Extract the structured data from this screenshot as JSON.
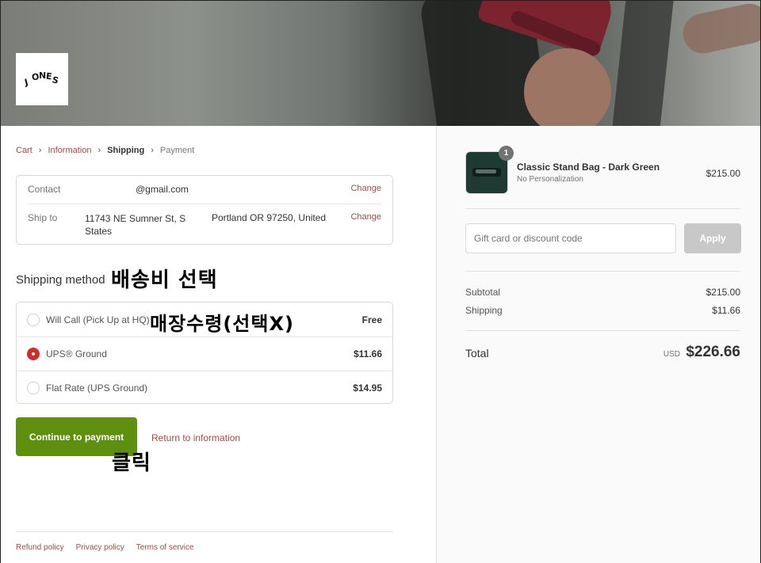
{
  "store": {
    "logo_text": "JONES"
  },
  "breadcrumb": {
    "cart": "Cart",
    "information": "Information",
    "shipping": "Shipping",
    "payment": "Payment"
  },
  "review": {
    "contact_label": "Contact",
    "contact_value": "@gmail.com",
    "shipto_label": "Ship to",
    "shipto_line1": "11743 NE Sumner St, S",
    "shipto_line1b": "States",
    "shipto_line2": "Portland OR 97250, United",
    "change": "Change"
  },
  "shipping_method": {
    "title": "Shipping method",
    "options": [
      {
        "name": "Will Call (Pick Up at HQ)",
        "price": "Free",
        "selected": false
      },
      {
        "name": "UPS® Ground",
        "price": "$11.66",
        "selected": true
      },
      {
        "name": "Flat Rate (UPS Ground)",
        "price": "$14.95",
        "selected": false
      }
    ]
  },
  "annotations": {
    "select_shipping": "배송비 선택",
    "store_pickup": "매장수령(선택X)",
    "click": "클릭"
  },
  "actions": {
    "continue": "Continue to payment",
    "return": "Return to information"
  },
  "footer": {
    "links": [
      "Refund policy",
      "Privacy policy",
      "Terms of service"
    ]
  },
  "order": {
    "product_name": "Classic Stand Bag - Dark Green",
    "product_variant": "No Personalization",
    "product_price": "$215.00",
    "quantity": "1",
    "discount_placeholder": "Gift card or discount code",
    "apply": "Apply",
    "subtotal_label": "Subtotal",
    "subtotal_value": "$215.00",
    "shipping_label": "Shipping",
    "shipping_value": "$11.66",
    "total_label": "Total",
    "currency": "USD",
    "total_value": "$226.66"
  },
  "colors": {
    "accent_link": "#a44a42",
    "primary_button": "#5f8f0f",
    "radio_selected": "#d42a2a"
  }
}
